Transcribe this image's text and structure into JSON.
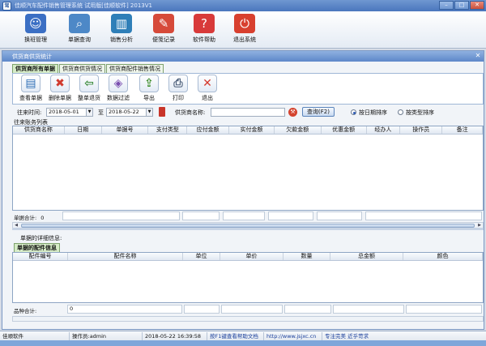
{
  "window": {
    "title": "佳顺汽车配件销售管理系统 试用版[佳顺软件] 2013V1",
    "app_icon_text": "驾",
    "controls": [
      "–",
      "□",
      "✕"
    ]
  },
  "main_toolbar": [
    {
      "label": "换班管理",
      "icon": "people-icon",
      "color": "#3b6fc4",
      "glyph": "☺"
    },
    {
      "label": "单据查询",
      "icon": "magnifier-icon",
      "color": "#4d88c7",
      "glyph": "⌕"
    },
    {
      "label": "销售分析",
      "icon": "bar-chart-icon",
      "color": "#2f7fb8",
      "glyph": "▥"
    },
    {
      "label": "便笺记录",
      "icon": "notepad-icon",
      "color": "#d64a3a",
      "glyph": "✎"
    },
    {
      "label": "软件帮助",
      "icon": "help-icon",
      "color": "#d83a3a",
      "glyph": "?"
    },
    {
      "label": "退出系统",
      "icon": "power-icon",
      "color": "#d8402f",
      "glyph": "⏻"
    }
  ],
  "child_window": {
    "title": "供货商供货统计",
    "close": "✕"
  },
  "tabs": [
    {
      "label": "供货商所有单据",
      "active": true
    },
    {
      "label": "供货商供货情况",
      "active": false
    },
    {
      "label": "供货商配件销售情况",
      "active": false
    }
  ],
  "actions": [
    {
      "label": "查看单据",
      "icon": "view-document-icon",
      "glyph": "▤",
      "color": "#2b6cb5"
    },
    {
      "label": "删除单据",
      "icon": "delete-x-icon",
      "glyph": "✖",
      "color": "#d13b2f"
    },
    {
      "label": "整单退货",
      "icon": "return-icon",
      "glyph": "⇦",
      "color": "#3a8a3a"
    },
    {
      "label": "数据过滤",
      "icon": "filter-icon",
      "glyph": "◈",
      "color": "#7a4fb0"
    },
    {
      "label": "导出",
      "icon": "export-icon",
      "glyph": "⇪",
      "color": "#3f8e2e"
    },
    {
      "label": "打印",
      "icon": "printer-icon",
      "glyph": "⎙",
      "color": "#4d5f7a"
    },
    {
      "label": "退出",
      "icon": "exit-icon",
      "glyph": "✕",
      "color": "#d5392d"
    }
  ],
  "search": {
    "date_label": "往来时间:",
    "date_from": "2018-05-01",
    "to_label": "至",
    "date_to": "2018-05-22",
    "supplier_label": "供货商名称:",
    "supplier_value": "",
    "query_button": "查询(F2)",
    "sort_options": [
      {
        "label": "按日期排序",
        "selected": true
      },
      {
        "label": "按类型排序",
        "selected": false
      }
    ]
  },
  "business_list": {
    "title": "往来账务列表",
    "columns": [
      "供货商名称",
      "日期",
      "单据号",
      "支付类型",
      "应付金额",
      "实付金额",
      "欠款金额",
      "优惠金额",
      "经办人",
      "操作员",
      "备注"
    ],
    "total_label": "单据合计:",
    "total_value": "0"
  },
  "detail": {
    "title": "单据的详细信息:",
    "tab": "单据的配件信息",
    "columns": [
      "配件编号",
      "配件名称",
      "单位",
      "单价",
      "数量",
      "总金额",
      "颜色"
    ],
    "total_label": "品种合计:",
    "total_value": "0"
  },
  "statusbar": {
    "company": "佳顺软件",
    "operator": "操作员:admin",
    "datetime": "2018-05-22 16:39:58",
    "help_hint": "按F1键查看帮助文档",
    "url": "http://www.jsjxc.cn",
    "slogan": "专注完美 近乎苛求"
  }
}
